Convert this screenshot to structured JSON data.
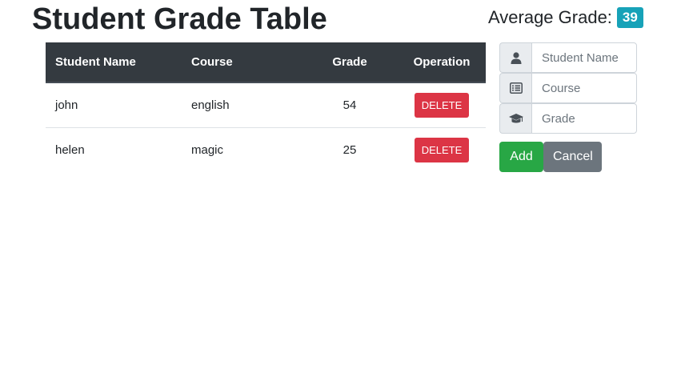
{
  "header": {
    "title": "Student Grade Table",
    "average_label": "Average Grade:",
    "average_value": "39"
  },
  "table": {
    "columns": [
      "Student Name",
      "Course",
      "Grade",
      "Operation"
    ],
    "rows": [
      {
        "name": "john",
        "course": "english",
        "grade": "54",
        "action": "DELETE"
      },
      {
        "name": "helen",
        "course": "magic",
        "grade": "25",
        "action": "DELETE"
      }
    ]
  },
  "form": {
    "name_placeholder": "Student Name",
    "course_placeholder": "Course",
    "grade_placeholder": "Grade",
    "name_icon": "user-icon",
    "course_icon": "list-icon",
    "grade_icon": "graduation-cap-icon",
    "add_label": "Add",
    "cancel_label": "Cancel"
  },
  "colors": {
    "header_bg": "#343a40",
    "badge": "#17a2b8",
    "delete": "#dc3545",
    "add": "#28a745",
    "cancel": "#6c757d"
  }
}
